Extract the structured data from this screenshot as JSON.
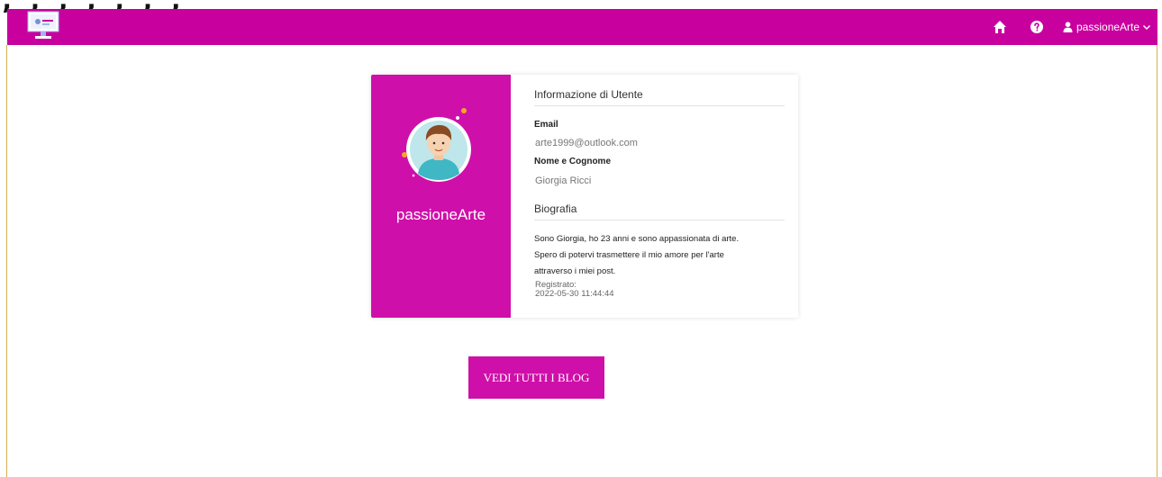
{
  "caption": ", , , , , , ,",
  "navbar": {
    "user_label": "passioneArte"
  },
  "profile": {
    "username": "passioneArte",
    "info_title": "Informazione di Utente",
    "email_label": "Email",
    "email_value": "arte1999@outlook.com",
    "name_label": "Nome e Cognome",
    "name_value": "Giorgia Ricci",
    "bio_title": "Biografia",
    "bio_lines": [
      "Sono Giorgia, ho 23 anni e sono appassionata di arte.",
      "Spero di potervi trasmettere il mio amore per l'arte",
      "attraverso i miei post."
    ],
    "registered_label": "Registrato:",
    "registered_value": "2022-05-30 11:44:44"
  },
  "actions": {
    "view_blogs_label": "VEDI TUTTI I BLOG"
  },
  "colors": {
    "navbar": "#c8009e",
    "card_accent": "#cf0fa9",
    "frame": "#d4b24a"
  },
  "icons": [
    "logo-icon",
    "home-icon",
    "help-icon",
    "user-icon",
    "chevron-down-icon",
    "avatar"
  ]
}
